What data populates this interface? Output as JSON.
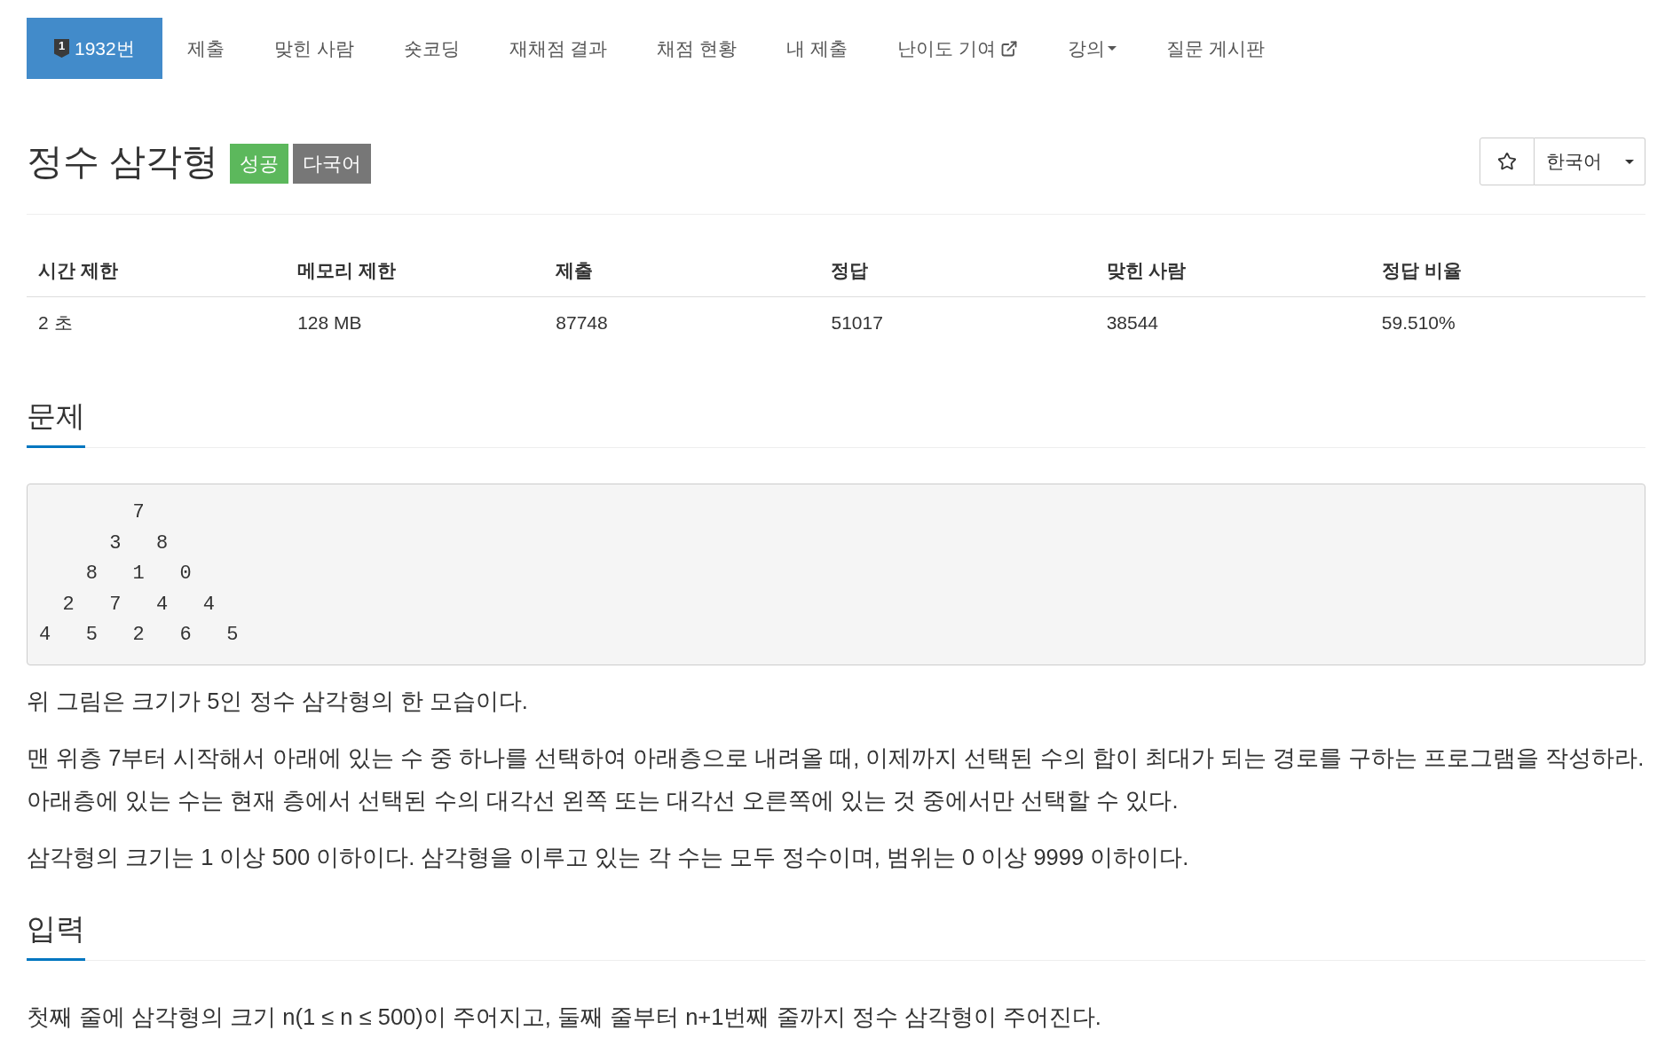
{
  "nav": {
    "tabs": [
      {
        "label": "1932번",
        "badge": "1",
        "selected": true,
        "kind": "link"
      },
      {
        "label": "제출",
        "selected": false,
        "kind": "link"
      },
      {
        "label": "맞힌 사람",
        "selected": false,
        "kind": "link"
      },
      {
        "label": "숏코딩",
        "selected": false,
        "kind": "link"
      },
      {
        "label": "재채점 결과",
        "selected": false,
        "kind": "link"
      },
      {
        "label": "채점 현황",
        "selected": false,
        "kind": "link"
      },
      {
        "label": "내 제출",
        "selected": false,
        "kind": "link"
      },
      {
        "label": "난이도 기여",
        "selected": false,
        "kind": "external"
      },
      {
        "label": "강의",
        "selected": false,
        "kind": "dropdown"
      },
      {
        "label": "질문 게시판",
        "selected": false,
        "kind": "link"
      }
    ]
  },
  "title": {
    "text": "정수 삼각형",
    "badges": [
      {
        "label": "성공",
        "color": "#5cb85c"
      },
      {
        "label": "다국어",
        "color": "#777777"
      }
    ]
  },
  "language_select": {
    "value": "한국어"
  },
  "stats": {
    "columns": [
      "시간 제한",
      "메모리 제한",
      "제출",
      "정답",
      "맞힌 사람",
      "정답 비율"
    ],
    "rows": [
      [
        "2 초",
        "128 MB",
        "87748",
        "51017",
        "38544",
        "59.510%"
      ]
    ]
  },
  "sections": [
    {
      "heading": "문제",
      "blocks": [
        {
          "kind": "pre",
          "lines": [
            "        7",
            "      3   8",
            "    8   1   0",
            "  2   7   4   4",
            "4   5   2   6   5"
          ]
        },
        {
          "kind": "paragraph",
          "text": "위 그림은 크기가 5인 정수 삼각형의 한 모습이다."
        },
        {
          "kind": "paragraph",
          "text": "맨 위층 7부터 시작해서 아래에 있는 수 중 하나를 선택하여 아래층으로 내려올 때, 이제까지 선택된 수의 합이 최대가 되는 경로를 구하는 프로그램을 작성하라. 아래층에 있는 수는 현재 층에서 선택된 수의 대각선 왼쪽 또는 대각선 오른쪽에 있는 것 중에서만 선택할 수 있다."
        },
        {
          "kind": "paragraph",
          "text": "삼각형의 크기는 1 이상 500 이하이다. 삼각형을 이루고 있는 각 수는 모두 정수이며, 범위는 0 이상 9999 이하이다."
        }
      ]
    },
    {
      "heading": "입력",
      "blocks": [
        {
          "kind": "paragraph",
          "text": "첫째 줄에 삼각형의 크기 n(1 ≤ n ≤ 500)이 주어지고, 둘째 줄부터 n+1번째 줄까지 정수 삼각형이 주어진다."
        }
      ]
    }
  ]
}
